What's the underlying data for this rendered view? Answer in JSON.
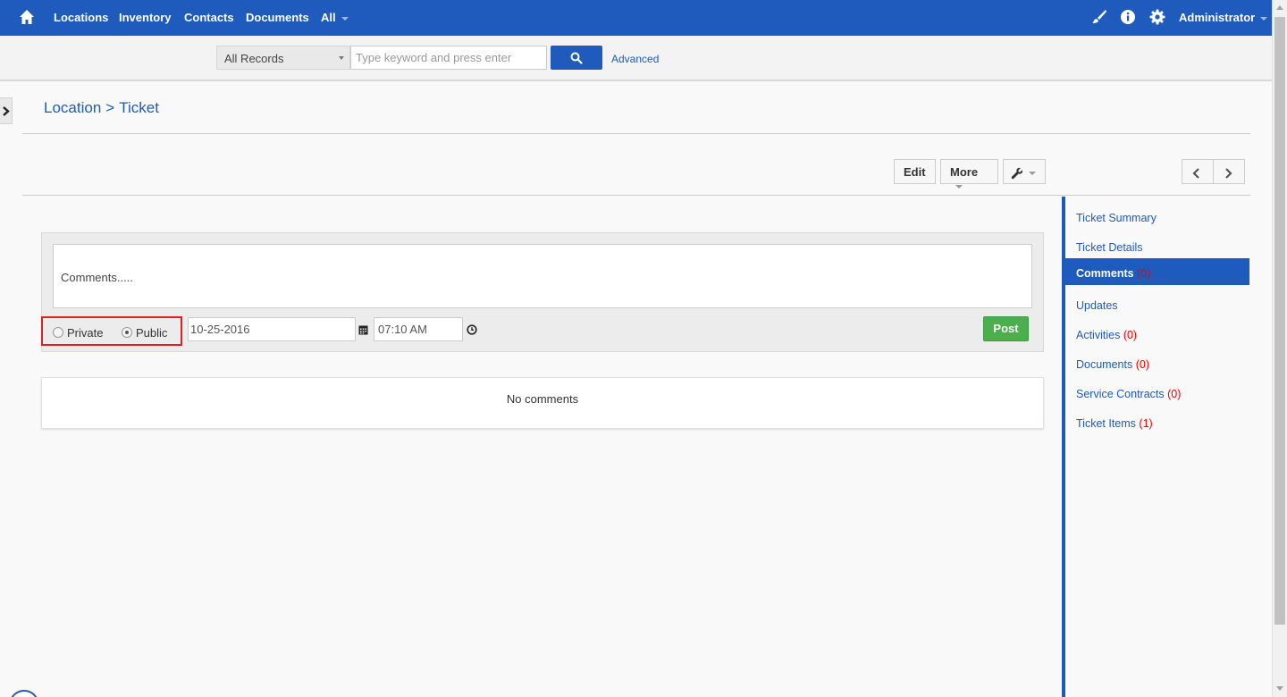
{
  "colors": {
    "brand": "#1e5bbd",
    "post": "#4cae4c",
    "highlight": "#e02020",
    "count": "#ee0000"
  },
  "topnav": {
    "home_icon": "home-icon",
    "links": [
      "Locations",
      "Inventory",
      "Contacts",
      "Documents",
      "All"
    ],
    "icons": [
      "brush-icon",
      "info-icon",
      "gear-icon"
    ],
    "user": "Administrator"
  },
  "search": {
    "scope": "All Records",
    "placeholder": "Type keyword and press enter",
    "button_icon": "search-icon",
    "advanced": "Advanced"
  },
  "breadcrumb": {
    "parent": "Location",
    "separator": ">",
    "current": "Ticket"
  },
  "toolbar": {
    "edit": "Edit",
    "more": "More",
    "tools_icon": "wrench-icon",
    "prev_icon": "chevron-left-icon",
    "next_icon": "chevron-right-icon"
  },
  "composer": {
    "text": "Comments.....",
    "private_label": "Private",
    "public_label": "Public",
    "selected": "Public",
    "date": "10-25-2016",
    "time": "07:10 AM",
    "post": "Post"
  },
  "comments": {
    "empty": "No comments"
  },
  "sidebar": {
    "items": [
      {
        "label": "Ticket Summary",
        "count": ""
      },
      {
        "label": "Ticket Details",
        "count": ""
      },
      {
        "label": "Comments",
        "count": "(0)"
      },
      {
        "label": "Updates",
        "count": ""
      },
      {
        "label": "Activities",
        "count": "(0)"
      },
      {
        "label": "Documents",
        "count": "(0)"
      },
      {
        "label": "Service Contracts",
        "count": "(0)"
      },
      {
        "label": "Ticket Items",
        "count": "(1)"
      }
    ],
    "active": "Comments"
  }
}
